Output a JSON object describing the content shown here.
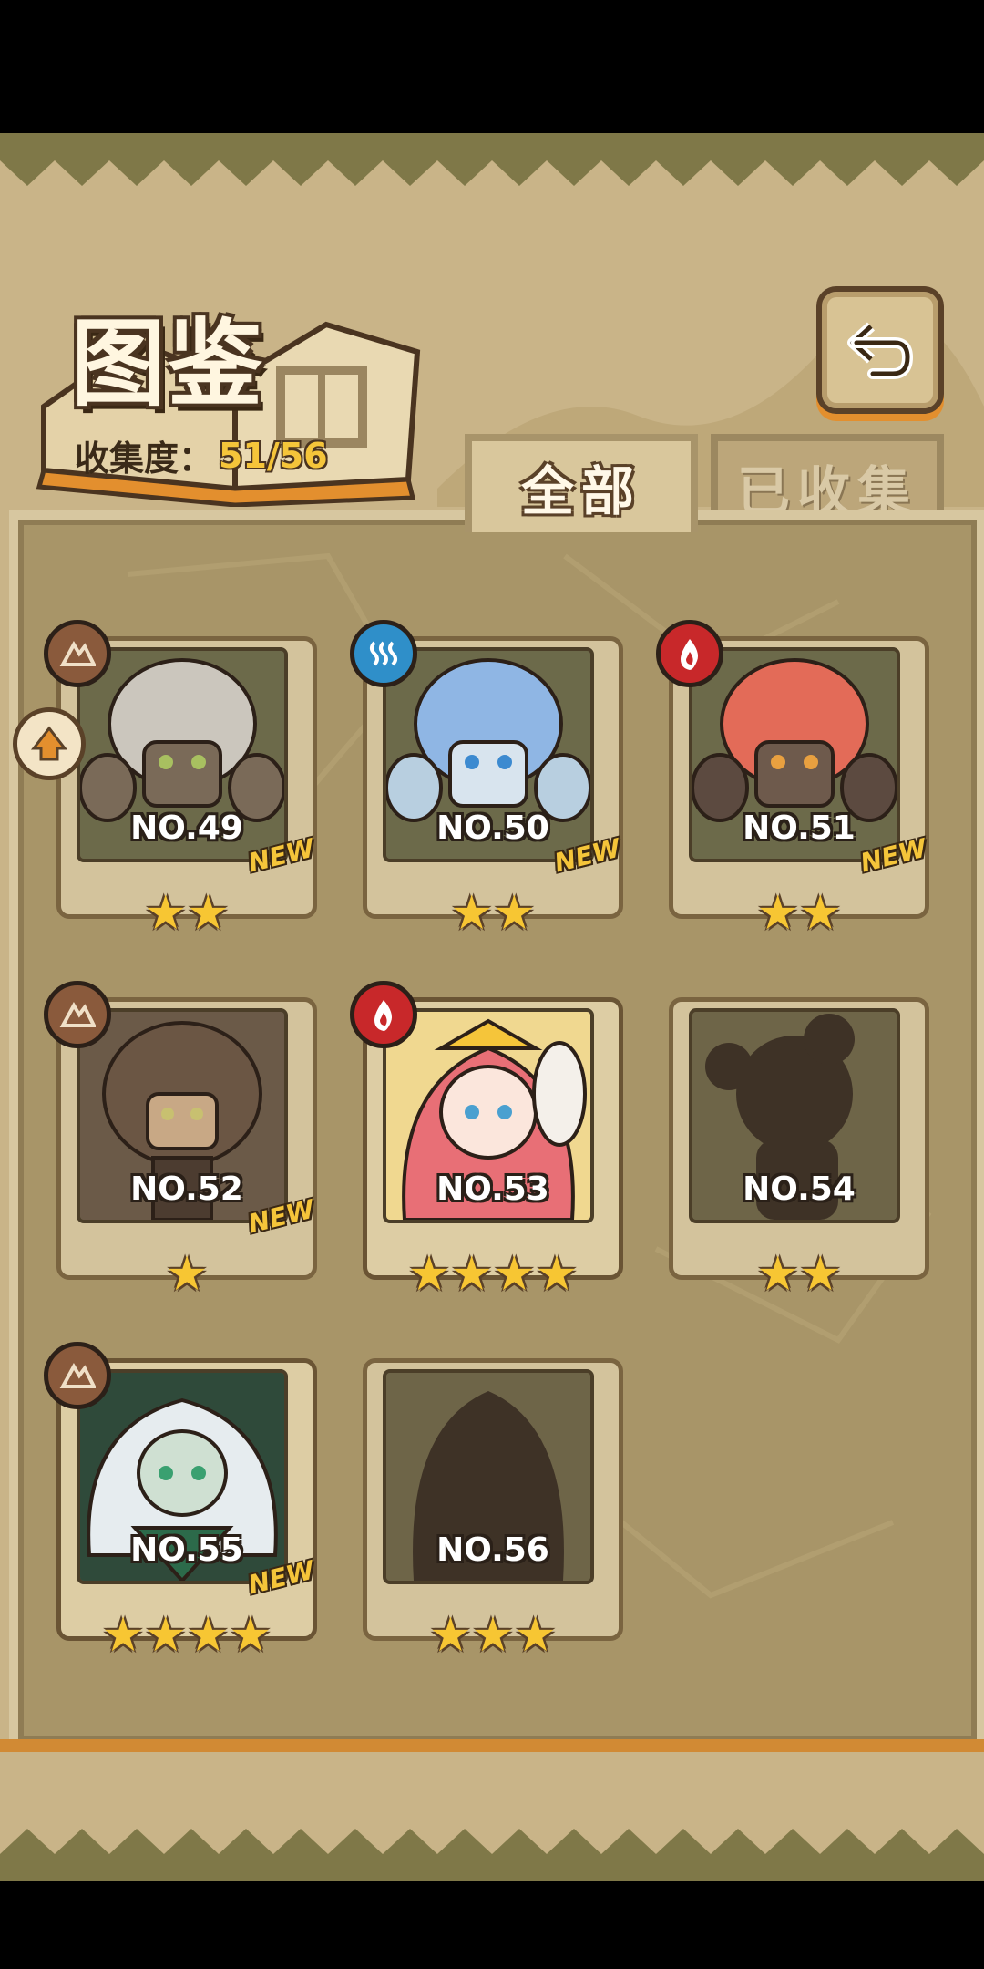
{
  "header": {
    "title": "图鉴",
    "collection_label": "收集度：",
    "collection_value": "51/56"
  },
  "tabs": [
    {
      "label": "全部",
      "active": true
    },
    {
      "label": "已收集",
      "active": false
    }
  ],
  "element_icons": {
    "earth": "mountain-icon",
    "water": "wave-icon",
    "fire": "flame-icon"
  },
  "element_colors": {
    "earth": "#8a5a3c",
    "water": "#2f8fc9",
    "fire": "#c8282a"
  },
  "cards": [
    {
      "label": "NO.49",
      "stars": "★★",
      "new": "NEW",
      "element": "earth"
    },
    {
      "label": "NO.50",
      "stars": "★★",
      "new": "NEW",
      "element": "water"
    },
    {
      "label": "NO.51",
      "stars": "★★",
      "new": "NEW",
      "element": "fire"
    },
    {
      "label": "NO.52",
      "stars": "★",
      "new": "NEW",
      "element": "earth"
    },
    {
      "label": "NO.53",
      "stars": "★★★★",
      "new": "",
      "element": "fire"
    },
    {
      "label": "NO.54",
      "stars": "★★",
      "new": "",
      "element": ""
    },
    {
      "label": "NO.55",
      "stars": "★★★★",
      "new": "NEW",
      "element": "earth"
    },
    {
      "label": "NO.56",
      "stars": "★★★",
      "new": "",
      "element": ""
    }
  ]
}
